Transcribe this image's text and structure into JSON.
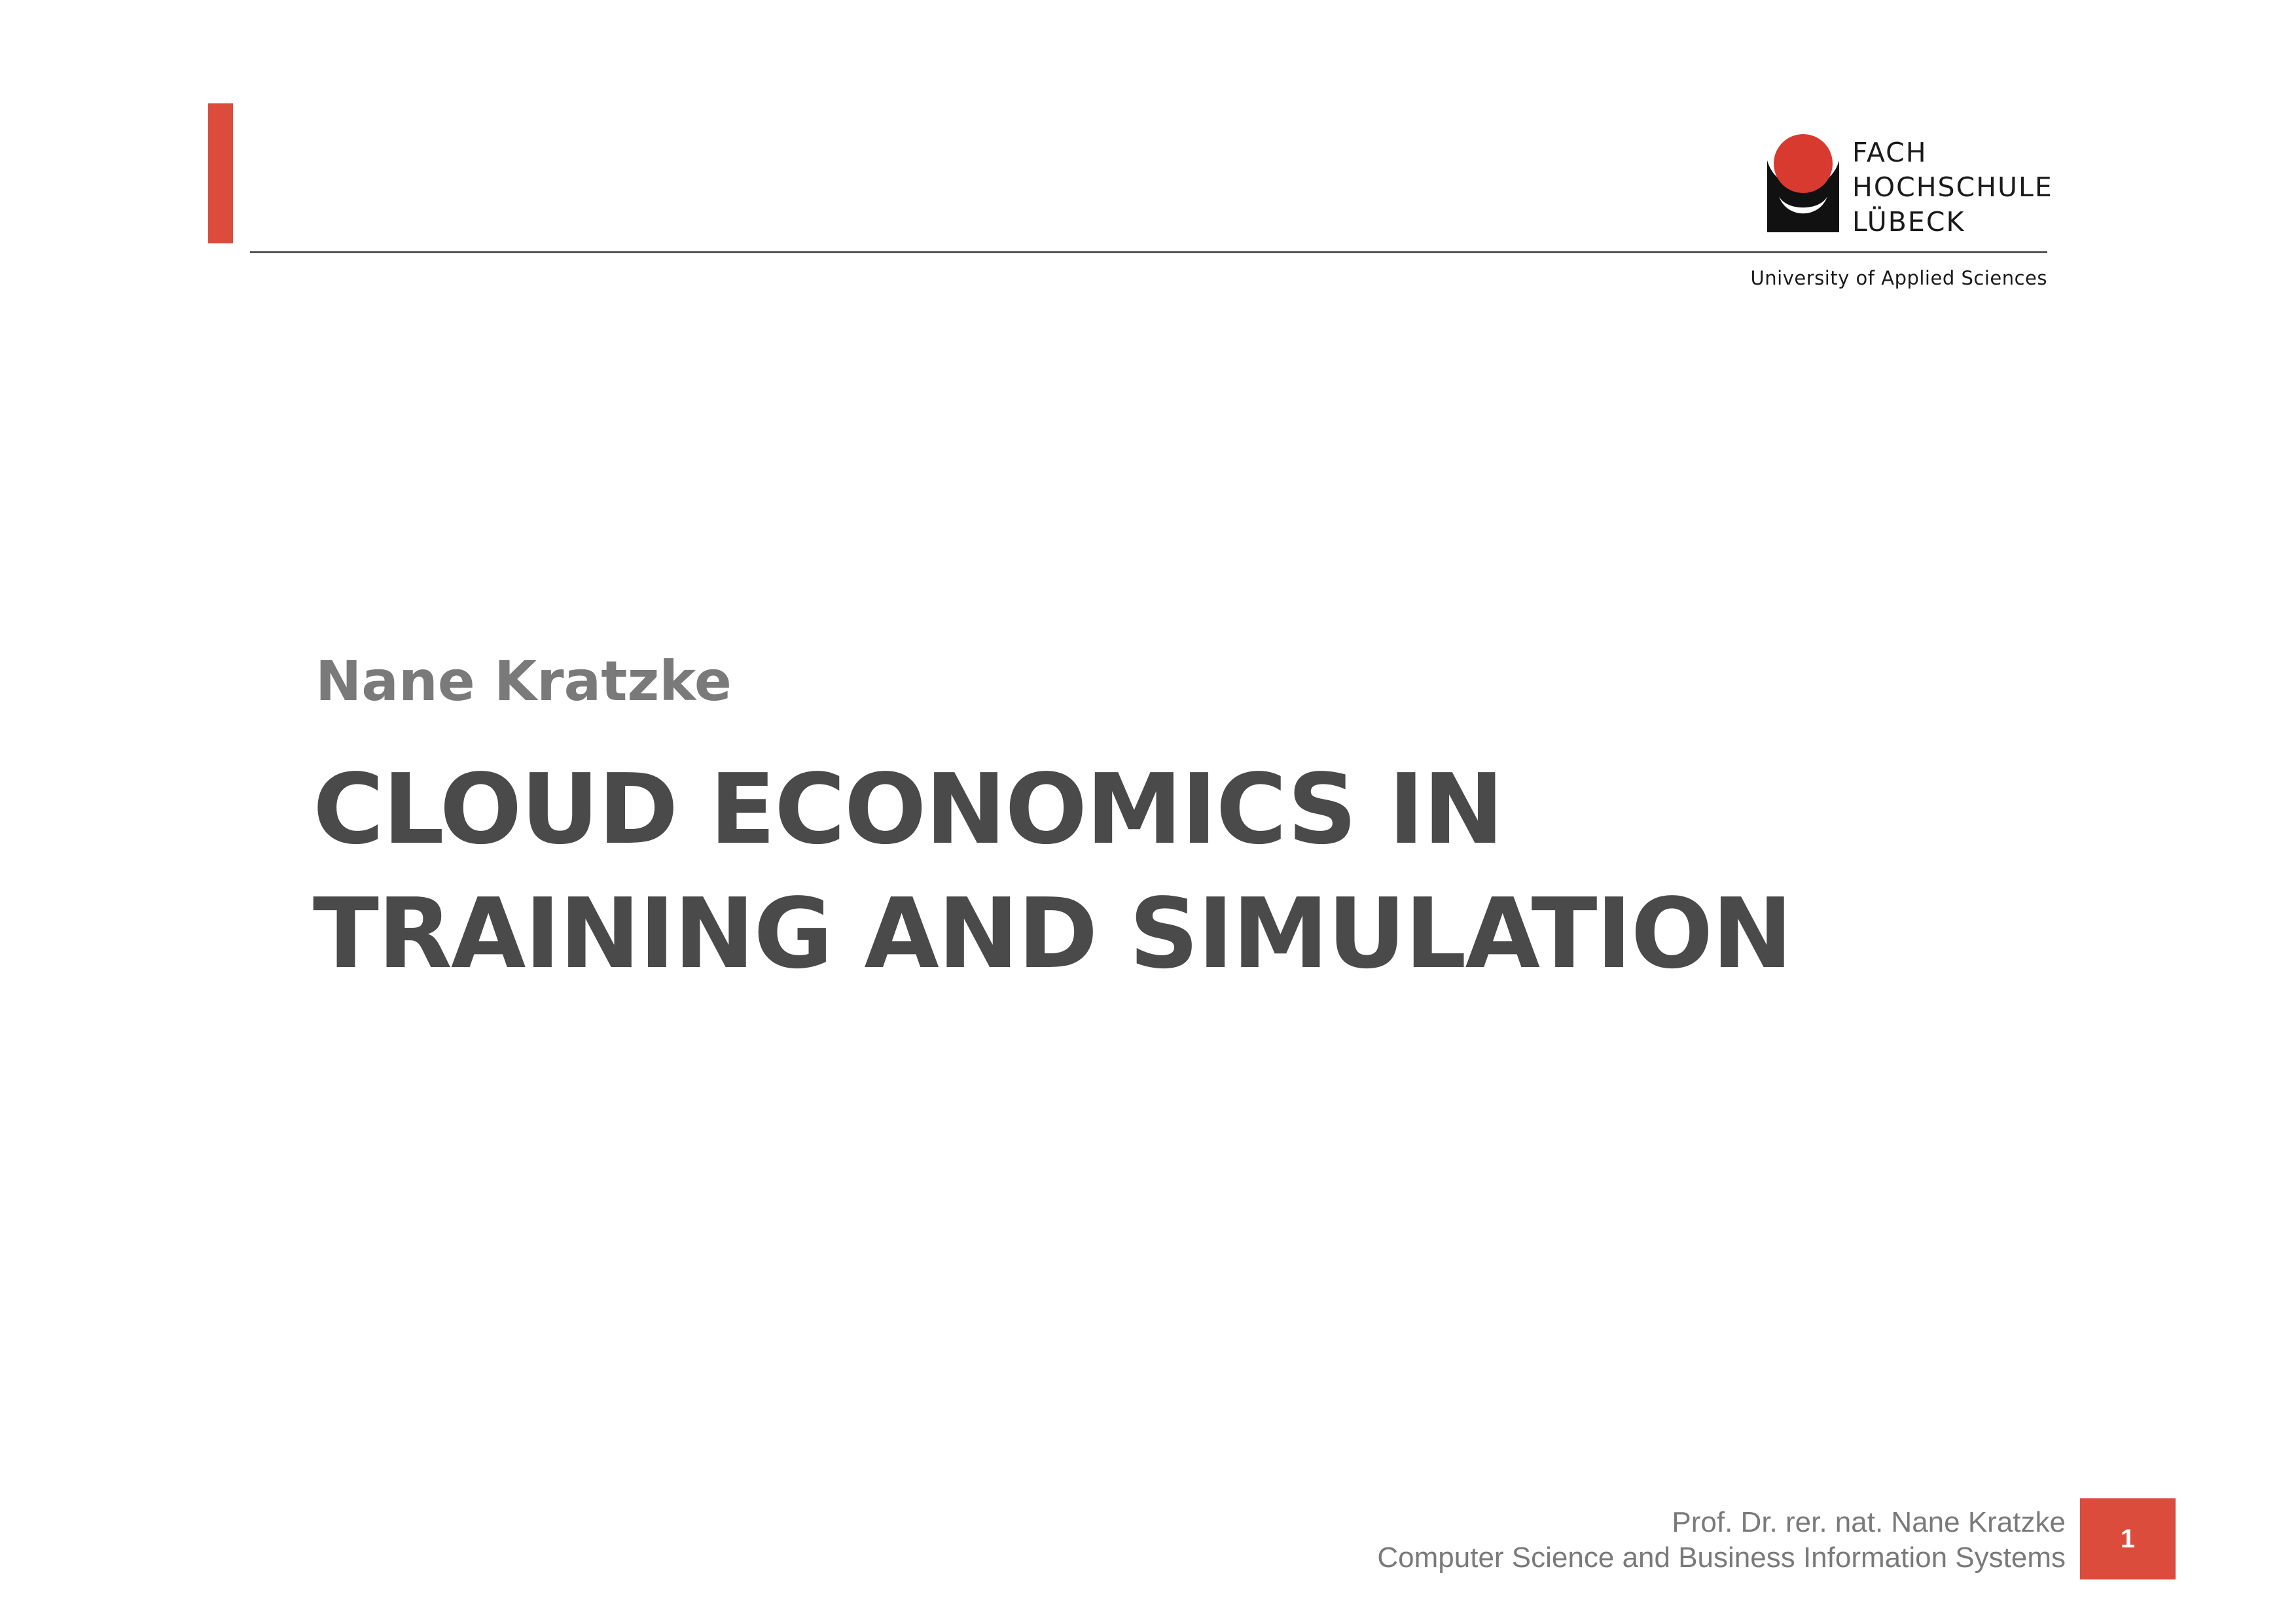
{
  "colors": {
    "accent": "#dc4c3c",
    "title": "#4a4a4a",
    "subtitle": "#7a7a7a",
    "logo_red": "#d93a2f",
    "logo_black": "#111111"
  },
  "header": {
    "logo": {
      "icon": "fh-luebeck-logo-icon",
      "lines": [
        "FACH",
        "HOCHSCHULE",
        "LÜBECK"
      ]
    },
    "university": "University of Applied Sciences"
  },
  "main": {
    "author": "Nane Kratzke",
    "title_lines": [
      "CLOUD ECONOMICS IN",
      "TRAINING AND SIMULATION"
    ]
  },
  "footer": {
    "presenter": "Prof. Dr. rer. nat. Nane Kratzke",
    "department": "Computer Science and Business Information Systems",
    "page_number": "1"
  }
}
